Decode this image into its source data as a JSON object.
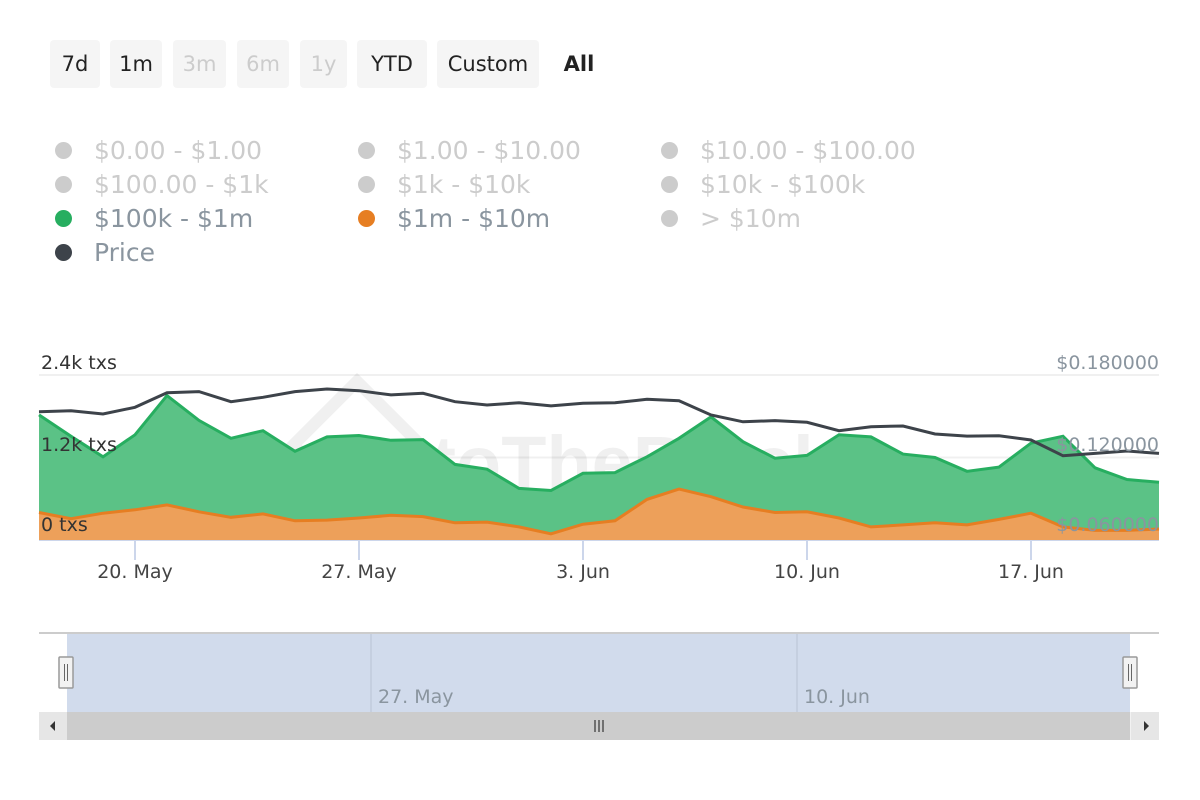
{
  "range_selector": {
    "buttons": [
      {
        "label": "7d",
        "state": "enabled"
      },
      {
        "label": "1m",
        "state": "enabled"
      },
      {
        "label": "3m",
        "state": "disabled"
      },
      {
        "label": "6m",
        "state": "disabled"
      },
      {
        "label": "1y",
        "state": "disabled"
      },
      {
        "label": "YTD",
        "state": "enabled"
      },
      {
        "label": "Custom",
        "state": "enabled"
      },
      {
        "label": "All",
        "state": "active"
      }
    ]
  },
  "legend": {
    "items": [
      {
        "label": "$0.00 - $1.00",
        "visible": false,
        "color": "#cccccc"
      },
      {
        "label": "$1.00 - $10.00",
        "visible": false,
        "color": "#cccccc"
      },
      {
        "label": "$10.00 - $100.00",
        "visible": false,
        "color": "#cccccc"
      },
      {
        "label": "$100.00 - $1k",
        "visible": false,
        "color": "#cccccc"
      },
      {
        "label": "$1k - $10k",
        "visible": false,
        "color": "#cccccc"
      },
      {
        "label": "$10k - $100k",
        "visible": false,
        "color": "#cccccc"
      },
      {
        "label": "$100k - $1m",
        "visible": true,
        "color": "#27ae60"
      },
      {
        "label": "$1m - $10m",
        "visible": true,
        "color": "#e67e22"
      },
      {
        "label": "> $10m",
        "visible": false,
        "color": "#cccccc"
      },
      {
        "label": "Price",
        "visible": true,
        "color": "#3d434a"
      }
    ]
  },
  "watermark": "IntoTheBlock",
  "chart_data": {
    "type": "area",
    "stacking": "normal",
    "x": [
      "17 May",
      "18 May",
      "19 May",
      "20 May",
      "21 May",
      "22 May",
      "23 May",
      "24 May",
      "25 May",
      "26 May",
      "27 May",
      "28 May",
      "29 May",
      "30 May",
      "31 May",
      "1 Jun",
      "2 Jun",
      "3 Jun",
      "4 Jun",
      "5 Jun",
      "6 Jun",
      "7 Jun",
      "8 Jun",
      "9 Jun",
      "10 Jun",
      "11 Jun",
      "12 Jun",
      "13 Jun",
      "14 Jun",
      "15 Jun",
      "16 Jun",
      "17 Jun",
      "18 Jun",
      "19 Jun",
      "20 Jun",
      "21 Jun"
    ],
    "x_ticks": [
      "20. May",
      "27. May",
      "3. Jun",
      "10. Jun",
      "17. Jun"
    ],
    "y_left": {
      "ticks": [
        "0 txs",
        "1.2k txs",
        "2.4k txs"
      ],
      "range": [
        0,
        2400
      ]
    },
    "y_right": {
      "ticks": [
        "$0.060000",
        "$0.120000",
        "$0.180000"
      ],
      "range": [
        0.06,
        0.18
      ]
    },
    "grid": true,
    "series": [
      {
        "name": "$1m - $10m",
        "type": "area",
        "color": "#e67e22",
        "values": [
          400,
          310,
          390,
          440,
          510,
          410,
          330,
          380,
          280,
          290,
          320,
          360,
          340,
          250,
          260,
          190,
          90,
          230,
          280,
          590,
          740,
          630,
          480,
          400,
          410,
          320,
          190,
          220,
          250,
          220,
          300,
          390,
          190,
          140,
          140,
          160
        ]
      },
      {
        "name": "$100k - $1m",
        "type": "area",
        "color": "#27ae60",
        "values": [
          1420,
          1200,
          820,
          1090,
          1590,
          1330,
          1150,
          1210,
          1010,
          1210,
          1200,
          1090,
          1120,
          850,
          770,
          560,
          630,
          740,
          700,
          620,
          740,
          1160,
          950,
          790,
          820,
          1210,
          1310,
          1030,
          950,
          780,
          760,
          1020,
          1320,
          910,
          740,
          680
        ]
      },
      {
        "name": "Price",
        "type": "line",
        "color": "#3d434a",
        "axis": "right",
        "values": [
          0.1533,
          0.154,
          0.1516,
          0.1565,
          0.1671,
          0.1679,
          0.1606,
          0.1638,
          0.1679,
          0.1698,
          0.1686,
          0.1655,
          0.1667,
          0.1606,
          0.1582,
          0.1598,
          0.1575,
          0.1594,
          0.1598,
          0.1623,
          0.1613,
          0.1509,
          0.146,
          0.1468,
          0.1456,
          0.1395,
          0.1424,
          0.1429,
          0.1371,
          0.1356,
          0.1358,
          0.1327,
          0.1213,
          0.123,
          0.1247,
          0.123
        ]
      }
    ]
  },
  "navigator": {
    "labels": [
      "27. May",
      "10. Jun"
    ],
    "scrollbar": {
      "left_arrow": "◂",
      "right_arrow": "▸",
      "grip": "|||"
    }
  }
}
